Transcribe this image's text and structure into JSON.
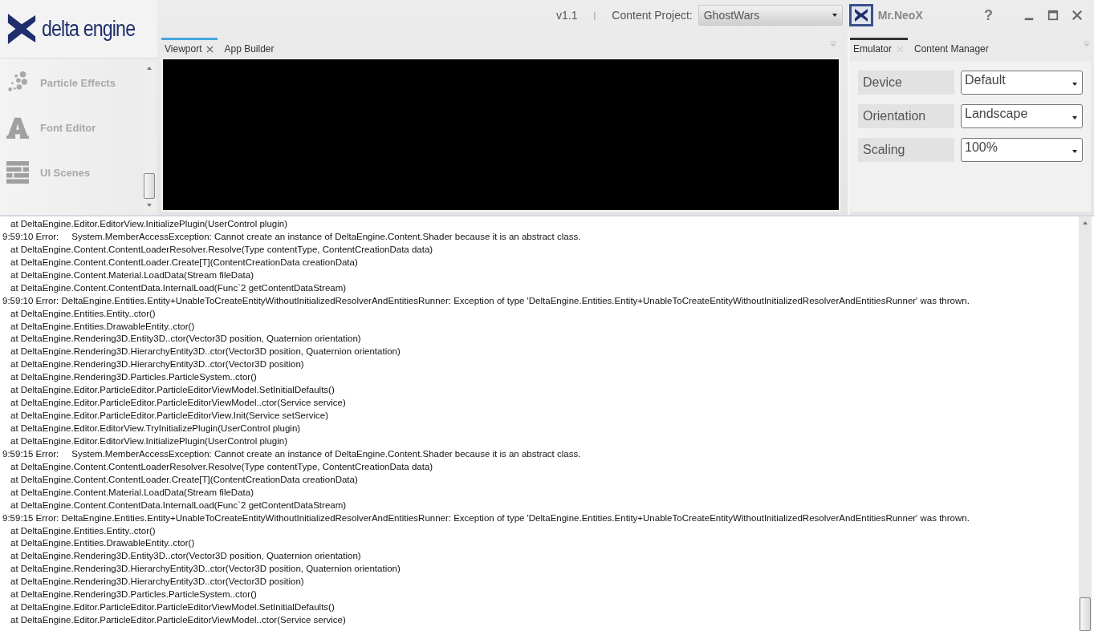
{
  "logo": {
    "text": "delta engine"
  },
  "header": {
    "version": "v1.1",
    "separator": "|",
    "project_label": "Content Project:",
    "project": "GhostWars",
    "user": "Mr.NeoX",
    "help": "?"
  },
  "sidebar": {
    "items": [
      {
        "label": "Particle Effects",
        "kind": "particles"
      },
      {
        "label": "Font Editor",
        "kind": "font"
      },
      {
        "label": "UI Scenes",
        "kind": "scenes"
      }
    ]
  },
  "center_tabs": [
    {
      "label": "Viewport",
      "selected": true,
      "closable": true
    },
    {
      "label": "App Builder",
      "selected": false,
      "closable": false
    }
  ],
  "right_tabs": [
    {
      "label": "Emulator",
      "selected": true,
      "closable": true
    },
    {
      "label": "Content Manager",
      "selected": false,
      "closable": false
    }
  ],
  "emulator": [
    {
      "label": "Device",
      "value": "Default"
    },
    {
      "label": "Orientation",
      "value": "Landscape"
    },
    {
      "label": "Scaling",
      "value": "100%"
    }
  ],
  "log": [
    {
      "kind": "trace",
      "text": "at DeltaEngine.Editor.EditorView.InitializePlugin(UserControl plugin)"
    },
    {
      "kind": "error",
      "text": "9:59:10 Error:     System.MemberAccessException: Cannot create an instance of DeltaEngine.Content.Shader because it is an abstract class."
    },
    {
      "kind": "trace",
      "text": "at DeltaEngine.Content.ContentLoaderResolver.Resolve(Type contentType, ContentCreationData data)"
    },
    {
      "kind": "trace",
      "text": "at DeltaEngine.Content.ContentLoader.Create[T](ContentCreationData creationData)"
    },
    {
      "kind": "trace",
      "text": "at DeltaEngine.Content.Material.LoadData(Stream fileData)"
    },
    {
      "kind": "trace",
      "text": "at DeltaEngine.Content.ContentData.InternalLoad(Func`2 getContentDataStream)"
    },
    {
      "kind": "error",
      "text": "9:59:10 Error: DeltaEngine.Entities.Entity+UnableToCreateEntityWithoutInitializedResolverAndEntitiesRunner: Exception of type 'DeltaEngine.Entities.Entity+UnableToCreateEntityWithoutInitializedResolverAndEntitiesRunner' was thrown."
    },
    {
      "kind": "trace",
      "text": "at DeltaEngine.Entities.Entity..ctor()"
    },
    {
      "kind": "trace",
      "text": "at DeltaEngine.Entities.DrawableEntity..ctor()"
    },
    {
      "kind": "trace",
      "text": "at DeltaEngine.Rendering3D.Entity3D..ctor(Vector3D position, Quaternion orientation)"
    },
    {
      "kind": "trace",
      "text": "at DeltaEngine.Rendering3D.HierarchyEntity3D..ctor(Vector3D position, Quaternion orientation)"
    },
    {
      "kind": "trace",
      "text": "at DeltaEngine.Rendering3D.HierarchyEntity3D..ctor(Vector3D position)"
    },
    {
      "kind": "trace",
      "text": "at DeltaEngine.Rendering3D.Particles.ParticleSystem..ctor()"
    },
    {
      "kind": "trace",
      "text": "at DeltaEngine.Editor.ParticleEditor.ParticleEditorViewModel.SetInitialDefaults()"
    },
    {
      "kind": "trace",
      "text": "at DeltaEngine.Editor.ParticleEditor.ParticleEditorViewModel..ctor(Service service)"
    },
    {
      "kind": "trace",
      "text": "at DeltaEngine.Editor.ParticleEditor.ParticleEditorView.Init(Service setService)"
    },
    {
      "kind": "trace",
      "text": "at DeltaEngine.Editor.EditorView.TryInitializePlugin(UserControl plugin)"
    },
    {
      "kind": "trace",
      "text": "at DeltaEngine.Editor.EditorView.InitializePlugin(UserControl plugin)"
    },
    {
      "kind": "error",
      "text": "9:59:15 Error:     System.MemberAccessException: Cannot create an instance of DeltaEngine.Content.Shader because it is an abstract class."
    },
    {
      "kind": "trace",
      "text": "at DeltaEngine.Content.ContentLoaderResolver.Resolve(Type contentType, ContentCreationData data)"
    },
    {
      "kind": "trace",
      "text": "at DeltaEngine.Content.ContentLoader.Create[T](ContentCreationData creationData)"
    },
    {
      "kind": "trace",
      "text": "at DeltaEngine.Content.Material.LoadData(Stream fileData)"
    },
    {
      "kind": "trace",
      "text": "at DeltaEngine.Content.ContentData.InternalLoad(Func`2 getContentDataStream)"
    },
    {
      "kind": "error",
      "text": "9:59:15 Error: DeltaEngine.Entities.Entity+UnableToCreateEntityWithoutInitializedResolverAndEntitiesRunner: Exception of type 'DeltaEngine.Entities.Entity+UnableToCreateEntityWithoutInitializedResolverAndEntitiesRunner' was thrown."
    },
    {
      "kind": "trace",
      "text": "at DeltaEngine.Entities.Entity..ctor()"
    },
    {
      "kind": "trace",
      "text": "at DeltaEngine.Entities.DrawableEntity..ctor()"
    },
    {
      "kind": "trace",
      "text": "at DeltaEngine.Rendering3D.Entity3D..ctor(Vector3D position, Quaternion orientation)"
    },
    {
      "kind": "trace",
      "text": "at DeltaEngine.Rendering3D.HierarchyEntity3D..ctor(Vector3D position, Quaternion orientation)"
    },
    {
      "kind": "trace",
      "text": "at DeltaEngine.Rendering3D.HierarchyEntity3D..ctor(Vector3D position)"
    },
    {
      "kind": "trace",
      "text": "at DeltaEngine.Rendering3D.Particles.ParticleSystem..ctor()"
    },
    {
      "kind": "trace",
      "text": "at DeltaEngine.Editor.ParticleEditor.ParticleEditorViewModel.SetInitialDefaults()"
    },
    {
      "kind": "trace",
      "text": "at DeltaEngine.Editor.ParticleEditor.ParticleEditorViewModel..ctor(Service service)"
    }
  ]
}
